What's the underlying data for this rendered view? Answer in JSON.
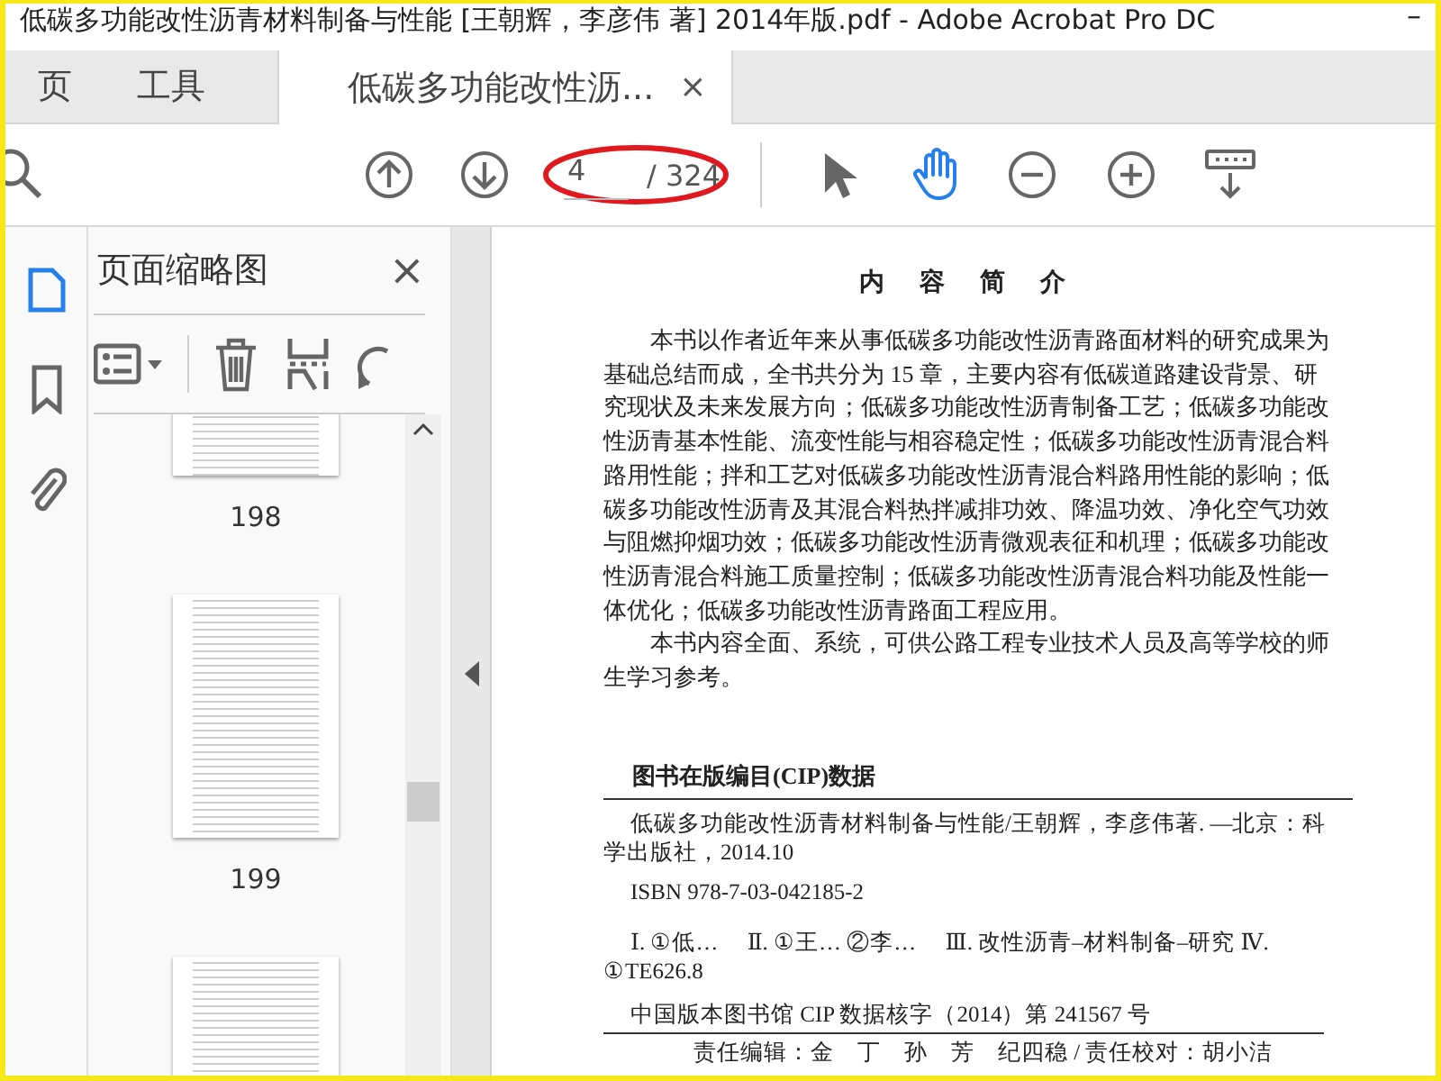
{
  "window": {
    "title": "低碳多功能改性沥青材料制备与性能 [王朝辉，李彦伟 著] 2014年版.pdf - Adobe Acrobat Pro DC",
    "minimize": "–"
  },
  "tabs": [
    {
      "label": "页",
      "selected": false
    },
    {
      "label": "工具",
      "selected": false
    },
    {
      "label": "低碳多功能改性沥...",
      "selected": true,
      "close": "×"
    }
  ],
  "toolbar": {
    "page_number": "4",
    "page_count": "/ 324",
    "tools": [
      {
        "kind": "select",
        "selected": false
      },
      {
        "kind": "hand",
        "selected": true
      }
    ]
  },
  "sidebar": {
    "rail": [
      {
        "kind": "thumbnails",
        "selected": true
      },
      {
        "kind": "bookmarks",
        "selected": false
      },
      {
        "kind": "attachments",
        "selected": false
      }
    ],
    "panel_title": "页面缩略图",
    "close": "×",
    "thumbnails": [
      {
        "label": "198",
        "kind": "cut-top"
      },
      {
        "label": "199",
        "kind": "full"
      },
      {
        "kind": "cut-bottom"
      }
    ]
  },
  "document": {
    "heading": "内 容 简 介",
    "paragraphs": [
      "本书以作者近年来从事低碳多功能改性沥青路面材料的研究成果为基础总结而成，全书共分为 15 章，主要内容有低碳道路建设背景、研究现状及未来发展方向；低碳多功能改性沥青制备工艺；低碳多功能改性沥青基本性能、流变性能与相容稳定性；低碳多功能改性沥青混合料路用性能；拌和工艺对低碳多功能改性沥青混合料路用性能的影响；低碳多功能改性沥青及其混合料热拌减排功效、降温功效、净化空气功效与阻燃抑烟功效；低碳多功能改性沥青微观表征和机理；低碳多功能改性沥青混合料施工质量控制；低碳多功能改性沥青混合料功能及性能一体优化；低碳多功能改性沥青路面工程应用。",
      "本书内容全面、系统，可供公路工程专业技术人员及高等学校的师生学习参考。"
    ],
    "cip_heading": "图书在版编目(CIP)数据",
    "cip_lines": [
      "低碳多功能改性沥青材料制备与性能/王朝辉，李彦伟著. —北京：科学出版社，2014.10",
      "ISBN  978-7-03-042185-2",
      "Ⅰ. ①低…　 Ⅱ. ①王…  ②李…　 Ⅲ. 改性沥青–材料制备–研究 Ⅳ. ①TE626.8"
    ],
    "cip_note": "中国版本图书馆 CIP 数据核字（2014）第 241567 号",
    "credits": "责任编辑：金　丁　孙　芳　纪四稳 / 责任校对：胡小洁"
  }
}
